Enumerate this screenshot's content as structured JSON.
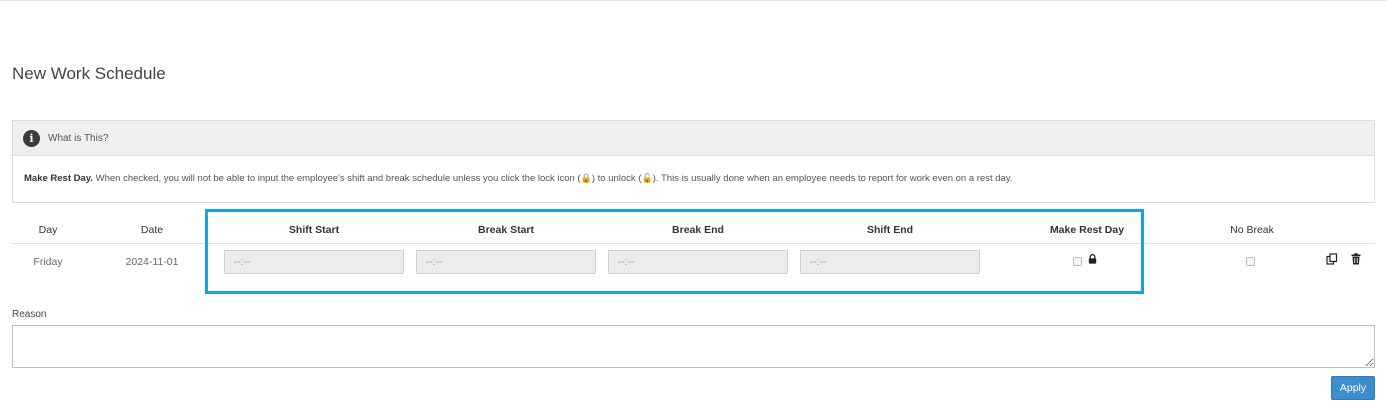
{
  "page": {
    "title": "New Work Schedule"
  },
  "info": {
    "header": "What is This?",
    "term": "Make Rest Day.",
    "text_before_lock": " When checked, you will not be able to input the employee's shift and break schedule unless you click the lock icon (",
    "lock_glyph": "🔒",
    "text_between": ") to unlock (",
    "unlock_glyph": "🔓",
    "text_after": "). This is usually done when an employee needs to report for work even on a rest day."
  },
  "table": {
    "headers": {
      "day": "Day",
      "date": "Date",
      "shift_start": "Shift Start",
      "break_start": "Break Start",
      "break_end": "Break End",
      "shift_end": "Shift End",
      "make_rest_day": "Make Rest Day",
      "no_break": "No Break"
    },
    "rows": [
      {
        "day": "Friday",
        "date": "2024-11-01",
        "shift_start_placeholder": "--:--",
        "break_start_placeholder": "--:--",
        "break_end_placeholder": "--:--",
        "shift_end_placeholder": "--:--",
        "make_rest_day_checked": false,
        "rest_day_lock": "locked",
        "no_break_checked": false
      }
    ]
  },
  "icons": {
    "info": "info-icon",
    "lock": "lock-icon",
    "copy": "copy-icon",
    "delete": "trash-icon"
  },
  "reason": {
    "label": "Reason",
    "value": ""
  },
  "actions": {
    "apply_label": "Apply"
  },
  "colors": {
    "highlight_border": "#1ba1e2",
    "apply_button": "#3c8dcc",
    "unlock_icon": "#d9402b"
  }
}
